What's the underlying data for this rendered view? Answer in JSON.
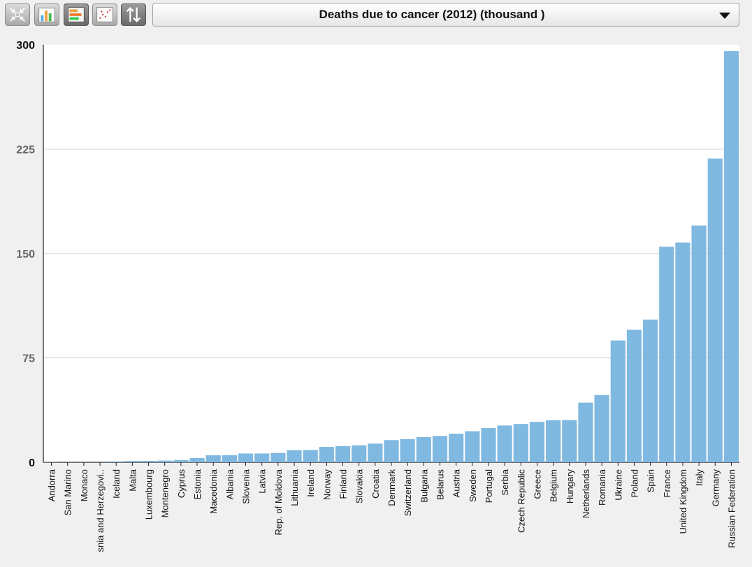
{
  "toolbar": {
    "icons": [
      "collapse-icon",
      "bar-chart-icon",
      "horizontal-bar-icon",
      "scatter-plot-icon",
      "sort-icon"
    ]
  },
  "selector": {
    "label": "Deaths due to cancer (2012) (thousand )"
  },
  "colors": {
    "bar": "#7fb8e0",
    "grid": "#c8c8c8",
    "axis": "#222222"
  },
  "chart_data": {
    "type": "bar",
    "title": "Deaths due to cancer (2012) (thousand )",
    "xlabel": "",
    "ylabel": "",
    "ylim": [
      0,
      300
    ],
    "yticks": [
      "0",
      "75",
      "150",
      "225",
      "300"
    ],
    "grid": true,
    "categories": [
      "Andorra",
      "San Marino",
      "Monaco",
      "snia and Herzegovi..",
      "Iceland",
      "Malta",
      "Luxembourg",
      "Montenegro",
      "Cyprus",
      "Estonia",
      "Macedonia",
      "Albania",
      "Slovenia",
      "Latvia",
      "Rep. of Moldova",
      "Lithuania",
      "Ireland",
      "Norway",
      "Finland",
      "Slovakia",
      "Croatia",
      "Denmark",
      "Switzerland",
      "Bulgaria",
      "Belarus",
      "Austria",
      "Sweden",
      "Portugal",
      "Serbia",
      "Czech Republic",
      "Greece",
      "Belgium",
      "Hungary",
      "Netherlands",
      "Romania",
      "Ukraine",
      "Poland",
      "Spain",
      "France",
      "United Kingdom",
      "Italy",
      "Germany",
      "Russian Federation"
    ],
    "values": [
      0.2,
      0.1,
      0.1,
      0.1,
      0.6,
      0.9,
      1.0,
      1.2,
      1.6,
      3.0,
      5.0,
      5.1,
      6.3,
      6.3,
      6.7,
      8.7,
      8.8,
      11.0,
      11.6,
      12.2,
      13.4,
      15.9,
      16.6,
      18.1,
      18.9,
      20.5,
      22.3,
      24.6,
      26.4,
      27.5,
      29.0,
      30.2,
      30.3,
      42.8,
      48.3,
      87.5,
      95.2,
      102.5,
      154.8,
      157.8,
      170.1,
      218.2,
      295.4
    ]
  }
}
